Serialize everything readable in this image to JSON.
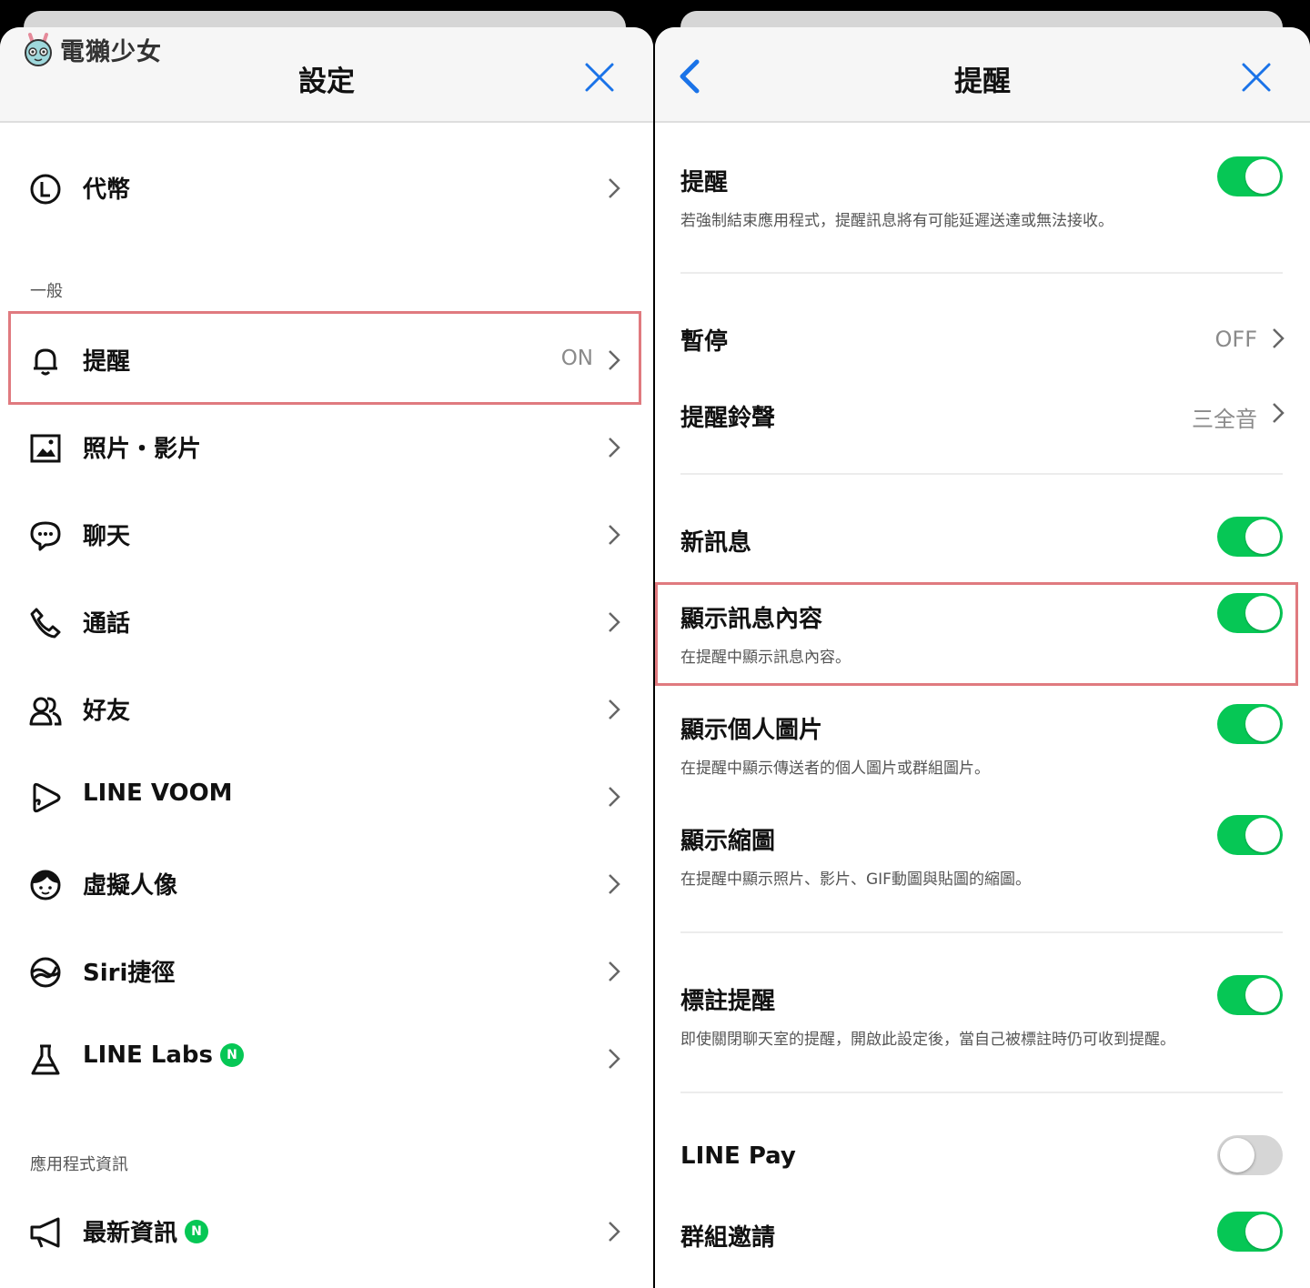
{
  "watermark": {
    "text": "電獺少女"
  },
  "left": {
    "title": "設定",
    "items_top": [
      {
        "label": "代幣",
        "icon": "coin-icon"
      }
    ],
    "section_general": "一般",
    "items_general": [
      {
        "label": "提醒",
        "value": "ON",
        "icon": "bell-icon"
      },
      {
        "label": "照片・影片",
        "icon": "photo-icon"
      },
      {
        "label": "聊天",
        "icon": "chat-icon"
      },
      {
        "label": "通話",
        "icon": "phone-icon"
      },
      {
        "label": "好友",
        "icon": "friends-icon"
      },
      {
        "label": "LINE VOOM",
        "icon": "voom-icon"
      },
      {
        "label": "虛擬人像",
        "icon": "avatar-icon"
      },
      {
        "label": "Siri捷徑",
        "icon": "siri-icon"
      },
      {
        "label": "LINE Labs",
        "badge": "N",
        "icon": "flask-icon"
      }
    ],
    "section_app_info": "應用程式資訊",
    "items_app_info": [
      {
        "label": "最新資訊",
        "badge": "N",
        "icon": "megaphone-icon"
      }
    ]
  },
  "right": {
    "title": "提醒",
    "notifications": {
      "title": "提醒",
      "desc": "若強制結束應用程式，提醒訊息將有可能延遲送達或無法接收。",
      "on": true
    },
    "pause": {
      "title": "暫停",
      "value": "OFF"
    },
    "sound": {
      "title": "提醒鈴聲",
      "value": "三全音"
    },
    "new_message": {
      "title": "新訊息",
      "on": true
    },
    "show_content": {
      "title": "顯示訊息內容",
      "desc": "在提醒中顯示訊息內容。",
      "on": true
    },
    "show_profile": {
      "title": "顯示個人圖片",
      "desc": "在提醒中顯示傳送者的個人圖片或群組圖片。",
      "on": true
    },
    "show_thumb": {
      "title": "顯示縮圖",
      "desc": "在提醒中顯示照片、影片、GIF動圖與貼圖的縮圖。",
      "on": true
    },
    "mention": {
      "title": "標註提醒",
      "desc": "即使關閉聊天室的提醒，開啟此設定後，當自己被標註時仍可收到提醒。",
      "on": true
    },
    "line_pay": {
      "title": "LINE Pay",
      "on": false
    },
    "group_invite": {
      "title": "群組邀請",
      "on": true
    }
  },
  "colors": {
    "accent_blue": "#1a73e8",
    "toggle_on": "#06c755",
    "toggle_off": "#d6d6d6",
    "highlight": "#e07a7f"
  }
}
